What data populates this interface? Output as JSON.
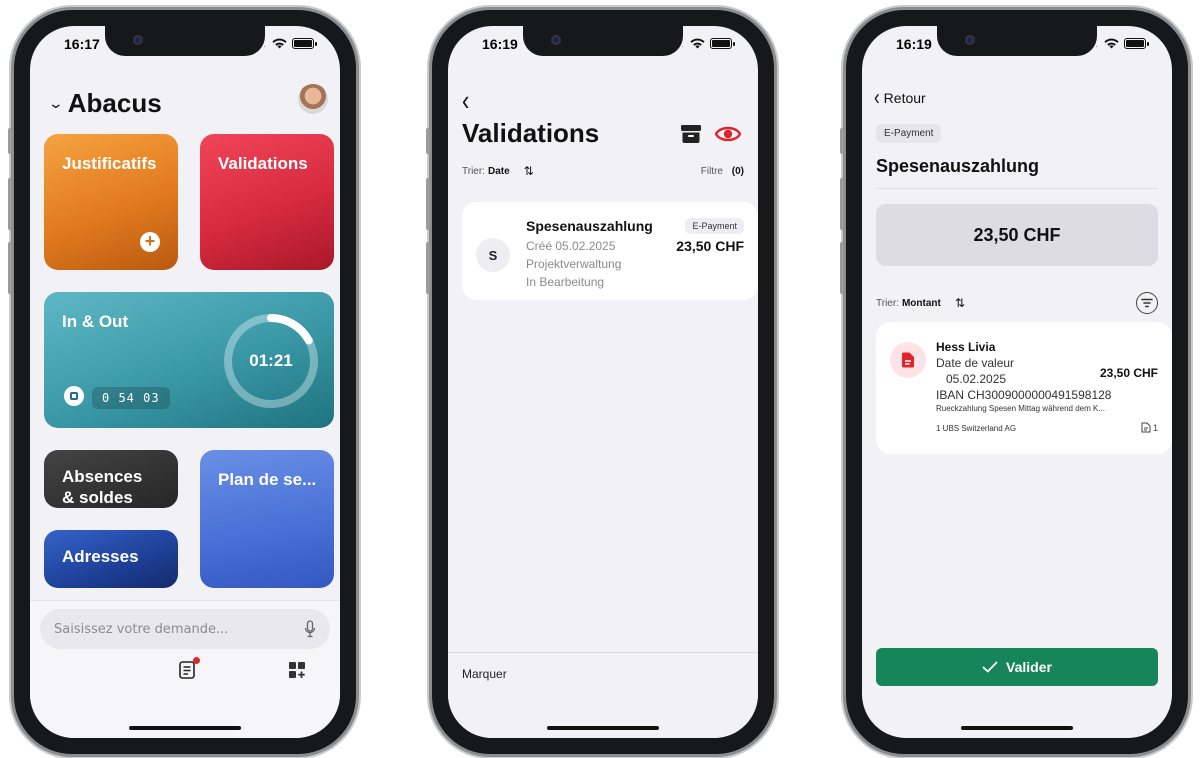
{
  "colors": {
    "accent_red": "#e0242e",
    "primary_green": "#16855a",
    "tile_orange": "#e27a1f",
    "tile_red": "#d72a3e",
    "tile_teal": "#3a98a6",
    "tile_dark": "#262626",
    "tile_navy": "#1e3f96",
    "tile_blue": "#4a72d7"
  },
  "phone1": {
    "time": "16:17",
    "org_name": "Abacus",
    "tiles": {
      "justificatifs": "Justificatifs",
      "validations": "Validations",
      "inout": "In & Out",
      "inout_ring": "01:21",
      "inout_progress": 0.17,
      "inout_timer": "0 54 03",
      "absences_line1": "Absences",
      "absences_line2": "& soldes",
      "adresses": "Adresses",
      "plan": "Plan de se..."
    },
    "search": {
      "placeholder": "Saisissez votre demande..."
    },
    "icons": [
      "chevron-down-icon",
      "avatar",
      "plus-icon",
      "stop-icon",
      "mic-icon",
      "document-icon",
      "grid-add-icon"
    ]
  },
  "phone2": {
    "time": "16:19",
    "title": "Validations",
    "sort": {
      "label": "Trier:",
      "value": "Date"
    },
    "filter": {
      "label": "Filtre",
      "count": "(0)"
    },
    "card": {
      "initial": "S",
      "title": "Spesenauszahlung",
      "created": "Créé 05.02.2025",
      "project": "Projektverwaltung",
      "status": "In Bearbeitung",
      "badge": "E-Payment",
      "amount": "23,50 CHF"
    },
    "bottom_action": "Marquer",
    "icons": [
      "back-chevron-icon",
      "archive-icon",
      "eye-icon",
      "sort-arrows-icon"
    ]
  },
  "phone3": {
    "time": "16:19",
    "back_label": "Retour",
    "badge": "E-Payment",
    "title": "Spesenauszahlung",
    "total": "23,50 CHF",
    "sort": {
      "label": "Trier:",
      "value": "Montant"
    },
    "card": {
      "name": "Hess Livia",
      "value_date_label": "Date de valeur",
      "value_date": "05.02.2025",
      "amount": "23,50  CHF",
      "iban": "IBAN CH3009000000491598128",
      "reference": "Rueckzahlung Spesen Mittag während dem K...",
      "bank": "1 UBS Switzerland AG",
      "attachments": "1"
    },
    "confirm_label": "Valider",
    "icons": [
      "back-chevron-icon",
      "filter-icon",
      "document-icon",
      "check-icon",
      "attachment-icon"
    ]
  }
}
